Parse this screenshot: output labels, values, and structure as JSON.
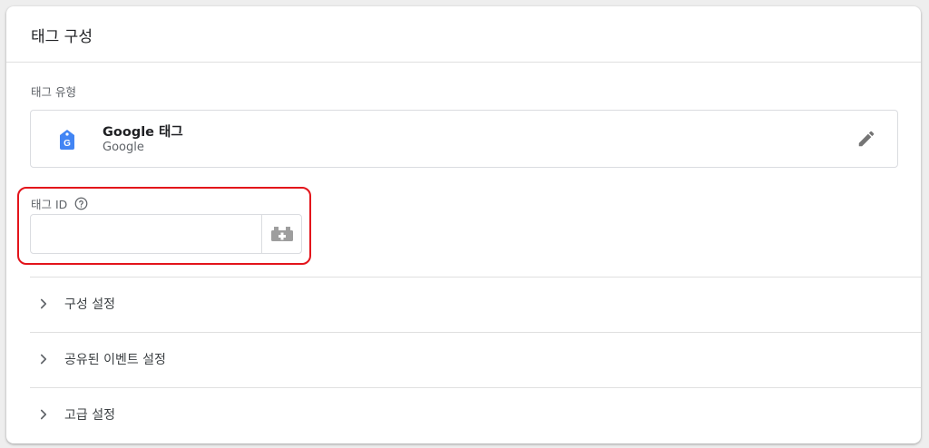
{
  "card": {
    "title": "태그 구성"
  },
  "tag_type": {
    "section_label": "태그 유형",
    "name": "Google 태그",
    "vendor": "Google",
    "icon": "google-tag-icon",
    "edit_icon": "pencil-icon"
  },
  "tag_id": {
    "label": "태그 ID",
    "help_icon": "help-circle-icon",
    "value": "",
    "placeholder": "",
    "variable_button_icon": "variable-brick-icon"
  },
  "sections": [
    {
      "label": "구성 설정",
      "icon": "chevron-right-icon"
    },
    {
      "label": "공유된 이벤트 설정",
      "icon": "chevron-right-icon"
    },
    {
      "label": "고급 설정",
      "icon": "chevron-right-icon"
    }
  ],
  "colors": {
    "highlight_border": "#e3141b",
    "google_blue": "#4285f4",
    "icon_gray": "#757575"
  }
}
